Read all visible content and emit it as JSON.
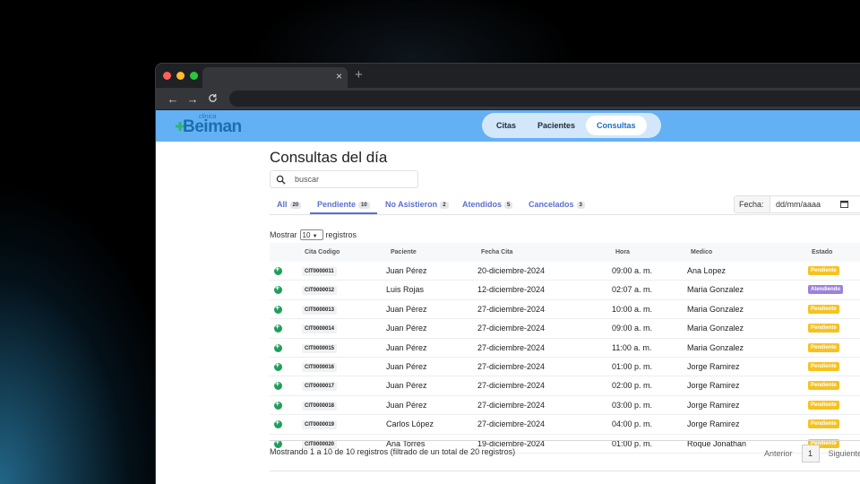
{
  "browser": {
    "tab_close": "×",
    "new_tab": "+",
    "back": "←",
    "forward": "→",
    "reload": "C"
  },
  "app": {
    "logo_small": "clinica",
    "logo_main": "Beiman",
    "nav": [
      {
        "label": "Citas",
        "active": false
      },
      {
        "label": "Pacientes",
        "active": false
      },
      {
        "label": "Consultas",
        "active": true
      }
    ]
  },
  "page": {
    "title": "Consultas del día",
    "search_placeholder": "buscar"
  },
  "filters": [
    {
      "label": "All",
      "count": "20",
      "active": false
    },
    {
      "label": "Pendiente",
      "count": "10",
      "active": true
    },
    {
      "label": "No Asistieron",
      "count": "2",
      "active": false
    },
    {
      "label": "Atendidos",
      "count": "5",
      "active": false
    },
    {
      "label": "Cancelados",
      "count": "3",
      "active": false
    }
  ],
  "date_filter": {
    "label": "Fecha:",
    "value": "dd/mm/aaaa"
  },
  "length": {
    "prefix": "Mostrar",
    "value": "10",
    "suffix": "registros"
  },
  "table": {
    "headers": [
      "Cita Codigo",
      "Paciente",
      "Fecha Cita",
      "Hora",
      "Medico",
      "Estado"
    ],
    "rows": [
      {
        "code": "CIT0000011",
        "paciente": "Juan Pérez",
        "fecha": "20-diciembre-2024",
        "hora": "09:00 a. m.",
        "medico": "Ana Lopez",
        "estado": "Pendiente"
      },
      {
        "code": "CIT0000012",
        "paciente": "Luis Rojas",
        "fecha": "12-diciembre-2024",
        "hora": "02:07 a. m.",
        "medico": "Maria Gonzalez",
        "estado": "Atendiendo"
      },
      {
        "code": "CIT0000013",
        "paciente": "Juan Pérez",
        "fecha": "27-diciembre-2024",
        "hora": "10:00 a. m.",
        "medico": "Maria Gonzalez",
        "estado": "Pendiente"
      },
      {
        "code": "CIT0000014",
        "paciente": "Juan Pérez",
        "fecha": "27-diciembre-2024",
        "hora": "09:00 a. m.",
        "medico": "Maria Gonzalez",
        "estado": "Pendiente"
      },
      {
        "code": "CIT0000015",
        "paciente": "Juan Pérez",
        "fecha": "27-diciembre-2024",
        "hora": "11:00 a. m.",
        "medico": "Maria Gonzalez",
        "estado": "Pendiente"
      },
      {
        "code": "CIT0000016",
        "paciente": "Juan Pérez",
        "fecha": "27-diciembre-2024",
        "hora": "01:00 p. m.",
        "medico": "Jorge Ramirez",
        "estado": "Pendiente"
      },
      {
        "code": "CIT0000017",
        "paciente": "Juan Pérez",
        "fecha": "27-diciembre-2024",
        "hora": "02:00 p. m.",
        "medico": "Jorge Ramirez",
        "estado": "Pendiente"
      },
      {
        "code": "CIT0000018",
        "paciente": "Juan Pérez",
        "fecha": "27-diciembre-2024",
        "hora": "03:00 p. m.",
        "medico": "Jorge Ramirez",
        "estado": "Pendiente"
      },
      {
        "code": "CIT0000019",
        "paciente": "Carlos López",
        "fecha": "27-diciembre-2024",
        "hora": "04:00 p. m.",
        "medico": "Jorge Ramirez",
        "estado": "Pendiente"
      },
      {
        "code": "CIT0000020",
        "paciente": "Ana Torres",
        "fecha": "19-diciembre-2024",
        "hora": "01:00 p. m.",
        "medico": "Roque Jonathan",
        "estado": "Pendiente"
      }
    ]
  },
  "footer": {
    "info": "Mostrando 1 a 10 de 10 registros (filtrado de un total de 20 registros)",
    "prev": "Anterior",
    "page": "1",
    "next": "Siguiente"
  },
  "colors": {
    "appbar": "#64b0f5",
    "accent": "#5a6fcf",
    "pendiente": "#f6c222",
    "atendiendo": "#9d82db",
    "expand": "#1f9e5a"
  }
}
